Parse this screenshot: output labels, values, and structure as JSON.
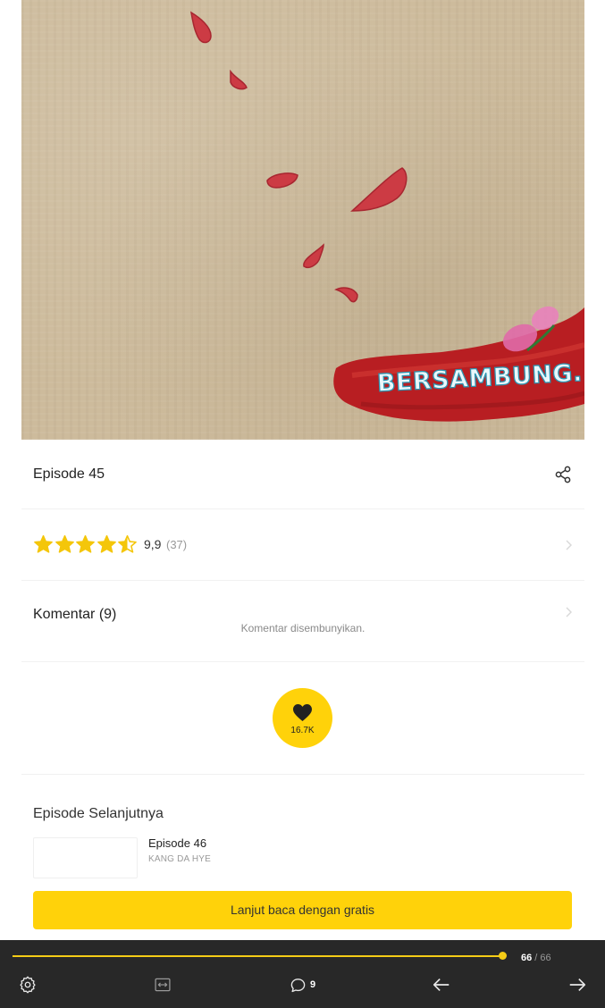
{
  "panel": {
    "caption": "BERSAMBUNG...",
    "colors": {
      "paper": "#cdbb9c",
      "petal": "#cc3b44",
      "brush": "#b81e22",
      "caption_text": "#eaf7fb",
      "caption_outline": "#2d94b0"
    }
  },
  "episode": {
    "title": "Episode 45",
    "share_icon": "share-icon"
  },
  "rating": {
    "score": 4.5,
    "max": 5,
    "value_text": "9,9",
    "count_text": "(37)"
  },
  "comments": {
    "title": "Komentar (9)",
    "hidden_text": "Komentar disembunyikan."
  },
  "like": {
    "count": "16.7K",
    "icon": "heart-icon"
  },
  "next_episode": {
    "heading": "Episode Selanjutnya",
    "episode_title": "Episode 46",
    "author": "KANG DA HYE",
    "cta_label": "Lanjut baca dengan gratis"
  },
  "reader_bar": {
    "progress": 1.0,
    "current_page": "66",
    "page_separator": " / ",
    "total_pages": "66",
    "comment_count": "9",
    "icons": [
      "settings-icon",
      "fit-width-icon",
      "comment-icon",
      "arrow-left-icon",
      "arrow-right-icon"
    ]
  },
  "theme": {
    "accent": "#ffd20a",
    "bar_bg": "#282828",
    "text": "#222222",
    "muted": "#999999"
  }
}
